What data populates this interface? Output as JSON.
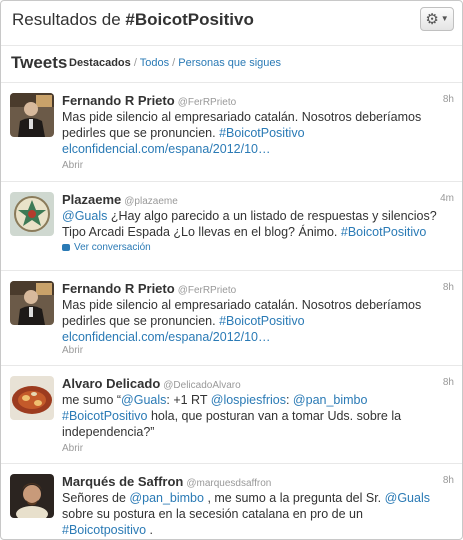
{
  "header": {
    "title_prefix": "Resultados de ",
    "title_query": "#BoicotPositivo"
  },
  "tabs": {
    "heading": "Tweets",
    "active": "Destacados",
    "sep1": " / ",
    "all": "Todos",
    "sep2": " / ",
    "following": "Personas que sigues"
  },
  "tweets": [
    {
      "name": "Fernando R Prieto",
      "handle": "@FerRPrieto",
      "time": "8h",
      "line1": "Mas pide silencio al empresariado catalán. Nosotros deberíamos",
      "line2a": "pedirles que se pronuncien. ",
      "line2b": "#BoicotPositivo",
      "line3": "elconfidencial.com/espana/2012/10…",
      "action": "Abrir"
    },
    {
      "name": "Plazaeme",
      "handle": "@plazaeme",
      "time": "4m",
      "line1a": "@Guals",
      "line1b": " ¿Hay algo parecido a un listado de respuestas y silencios?",
      "line2a": "Tipo Arcadi Espada ¿Lo llevas en el blog? Ánimo. ",
      "line2b": "#BoicotPositivo",
      "action": "Ver conversación"
    },
    {
      "name": "Fernando R Prieto",
      "handle": "@FerRPrieto",
      "time": "8h",
      "line1": "Mas pide silencio al empresariado catalán. Nosotros deberíamos",
      "line2a": "pedirles que se pronuncien. ",
      "line2b": "#BoicotPositivo",
      "line3": "elconfidencial.com/espana/2012/10…",
      "action": "Abrir"
    },
    {
      "name": "Alvaro Delicado",
      "handle": "@DelicadoAlvaro",
      "time": "8h",
      "line1a": "me sumo “",
      "line1b": "@Guals",
      "line1c": ": +1 RT ",
      "line1d": "@lospiesfrios",
      "line1e": ": ",
      "line1f": "@pan_bimbo",
      "line2a": "#BoicotPositivo",
      "line2b": " hola, que posturan van a tomar Uds. sobre la",
      "line3": "independencia?”",
      "action": "Abrir"
    },
    {
      "name": "Marqués de Saffron",
      "handle": "@marquesdsaffron",
      "time": "8h",
      "line1a": "Señores de ",
      "line1b": "@pan_bimbo",
      "line1c": " , me sumo a la pregunta del Sr. ",
      "line1d": "@Guals",
      "line2": "sobre su postura en la secesión catalana en pro de un",
      "line3": "#Boicotpositivo",
      "line3b": " ."
    }
  ],
  "colors": {
    "link": "#2a7ab5",
    "muted": "#999999",
    "text": "#333333"
  },
  "icons": {
    "settings": "gear-icon",
    "conversation": "speech-bubble-icon"
  }
}
